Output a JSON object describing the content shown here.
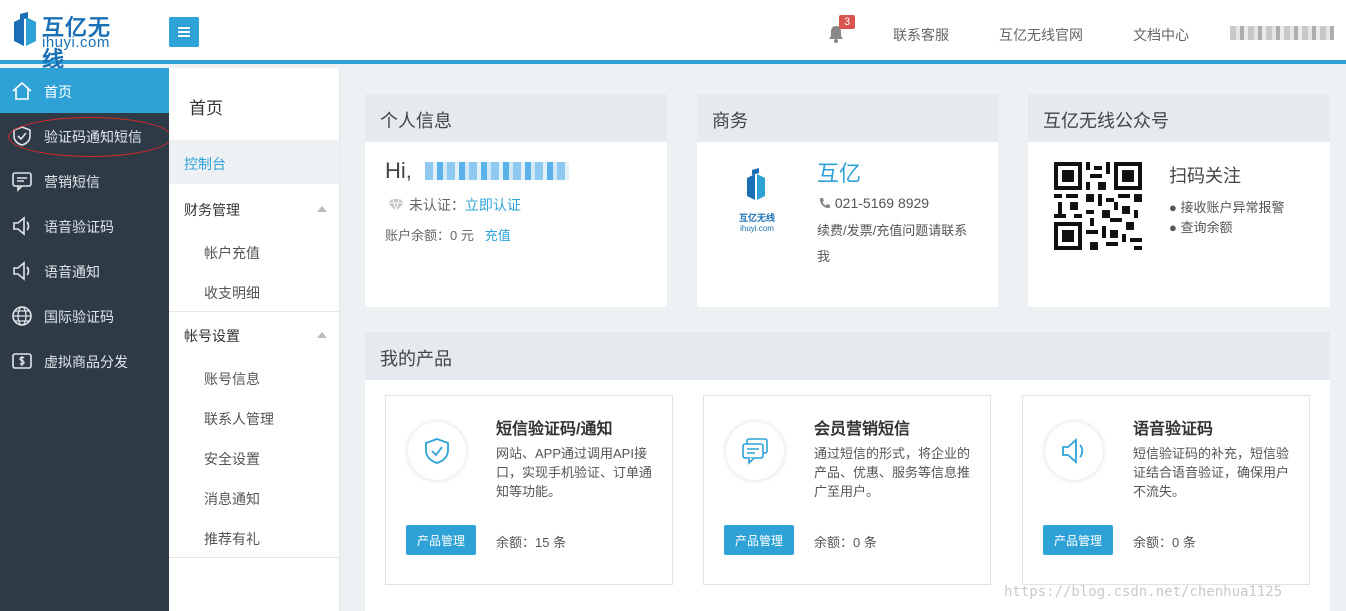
{
  "header": {
    "logo_cn": "互亿无线",
    "logo_en": "ihuyi.com",
    "notification_count": "3",
    "links": [
      "联系客服",
      "互亿无线官网",
      "文档中心"
    ]
  },
  "sidebar": {
    "items": [
      {
        "label": "首页",
        "icon": "home-icon"
      },
      {
        "label": "验证码通知短信",
        "icon": "shield-check-icon"
      },
      {
        "label": "营销短信",
        "icon": "message-icon"
      },
      {
        "label": "语音验证码",
        "icon": "speaker-icon"
      },
      {
        "label": "语音通知",
        "icon": "speaker-icon"
      },
      {
        "label": "国际验证码",
        "icon": "globe-icon"
      },
      {
        "label": "虚拟商品分发",
        "icon": "dollar-icon"
      }
    ]
  },
  "subnav": {
    "title": "首页",
    "dashboard": "控制台",
    "finance": "财务管理",
    "finance_items": [
      "帐户充值",
      "收支明细"
    ],
    "account": "帐号设置",
    "account_items": [
      "账号信息",
      "联系人管理",
      "安全设置",
      "消息通知",
      "推荐有礼"
    ]
  },
  "personal": {
    "title": "个人信息",
    "hi": "Hi,",
    "verify_status": "未认证：",
    "verify_link": "立即认证",
    "balance": "账户余额：0 元",
    "recharge": "充值"
  },
  "business": {
    "title": "商务",
    "logo_cn": "互亿无线",
    "logo_en": "ihuyi.com",
    "name": "互亿",
    "phone": "021-5169 8929",
    "note": "续费/发票/充值问题请联系我"
  },
  "wechat": {
    "title": "互亿无线公众号",
    "scan": "扫码关注",
    "items": [
      "接收账户异常报警",
      "查询余额"
    ]
  },
  "products": {
    "title": "我的产品",
    "cards": [
      {
        "title": "短信验证码/通知",
        "desc": "网站、APP通过调用API接口，实现手机验证、订单通知等功能。",
        "button": "产品管理",
        "left": "余额：15 条"
      },
      {
        "title": "会员营销短信",
        "desc": "通过短信的形式，将企业的产品、优惠、服务等信息推广至用户。",
        "button": "产品管理",
        "left": "余额：0 条"
      },
      {
        "title": "语音验证码",
        "desc": "短信验证码的补充，短信验证结合语音验证，确保用户不流失。",
        "button": "产品管理",
        "left": "余额：0 条"
      }
    ]
  },
  "watermark": "https://blog.csdn.net/chenhua1125",
  "colors": {
    "accent": "#2ea2d6",
    "sidebar": "#2e3a46",
    "panel_head": "#e4eaee"
  }
}
